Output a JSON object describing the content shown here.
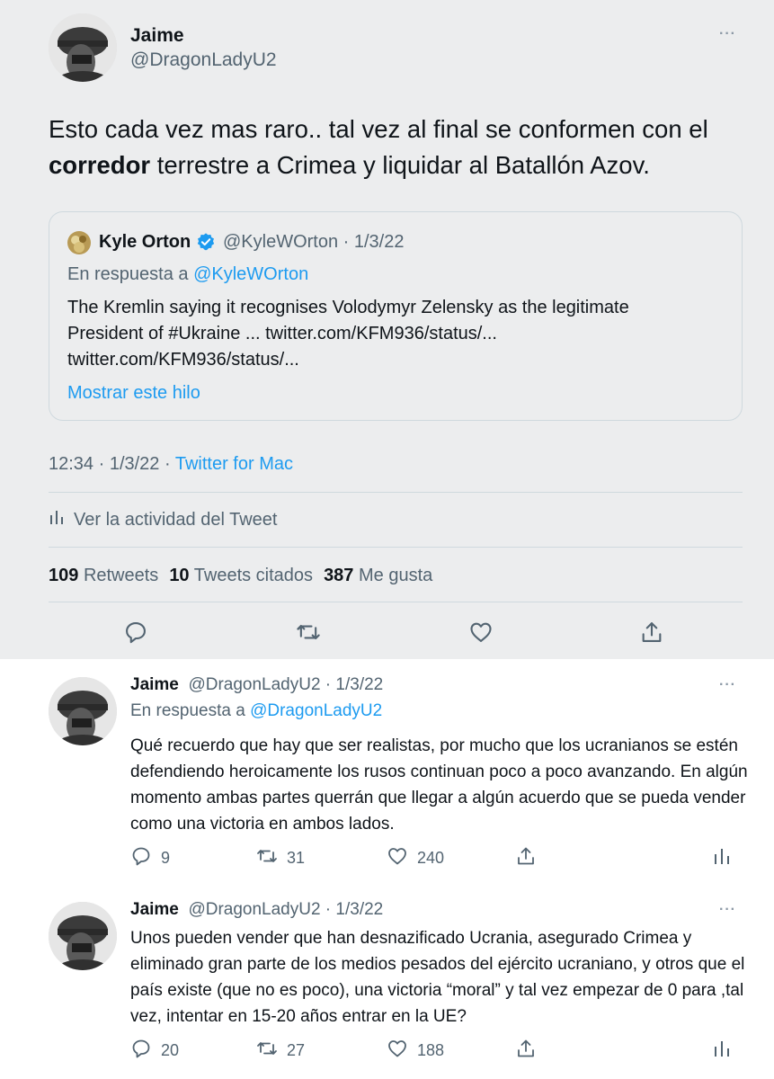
{
  "main_tweet": {
    "author_name": "Jaime",
    "author_handle": "@DragonLadyU2",
    "text_before": "Esto cada vez mas raro.. tal vez al final se conformen con el ",
    "text_bold": "corredor",
    "text_after": " terrestre a Crimea y liquidar al Batallón Azov.",
    "quote": {
      "author_name": "Kyle Orton",
      "meta": "@KyleWOrton · 1/3/22",
      "reply_prefix": "En respuesta a ",
      "reply_handle": "@KyleWOrton",
      "text": "The Kremlin saying it recognises Volodymyr Zelensky as the legitimate President of #Ukraine ... twitter.com/KFM936/status/... twitter.com/KFM936/status/...",
      "show_thread": "Mostrar este hilo"
    },
    "time": "12:34 · 1/3/22 · ",
    "source": "Twitter for Mac",
    "activity_label": "Ver la actividad del Tweet",
    "stats": {
      "retweets_count": "109",
      "retweets_label": "Retweets",
      "quotes_count": "10",
      "quotes_label": "Tweets citados",
      "likes_count": "387",
      "likes_label": "Me gusta"
    }
  },
  "replies": [
    {
      "author_name": "Jaime",
      "meta": "@DragonLadyU2 · 1/3/22",
      "reply_prefix": "En respuesta a ",
      "reply_handle": "@DragonLadyU2",
      "text": "Qué recuerdo que hay que ser realistas, por mucho que los ucranianos se estén defendiendo heroicamente los rusos continuan poco a poco avanzando. En algún momento ambas partes querrán que llegar a algún acuerdo que se pueda vender como una victoria en ambos lados.",
      "reply_count": "9",
      "retweet_count": "31",
      "like_count": "240"
    },
    {
      "author_name": "Jaime",
      "meta": "@DragonLadyU2 · 1/3/22",
      "text": "Unos pueden vender que han desnazificado Ucrania, asegurado Crimea y eliminado gran parte de los medios pesados del ejército ucraniano, y otros que el país existe (que no es poco), una victoria “moral” y tal vez empezar de 0 para ,tal vez, intentar en 15-20 años entrar en la UE?",
      "reply_count": "20",
      "retweet_count": "27",
      "like_count": "188"
    }
  ],
  "icons": {
    "more": "···",
    "verified": "verified-badge-icon",
    "reply": "reply-icon",
    "retweet": "retweet-icon",
    "like": "like-icon",
    "share": "share-icon",
    "analytics": "analytics-icon"
  },
  "colors": {
    "accent": "#1d9bf0",
    "secondary_text": "#536471",
    "main_background": "#ecedee"
  }
}
